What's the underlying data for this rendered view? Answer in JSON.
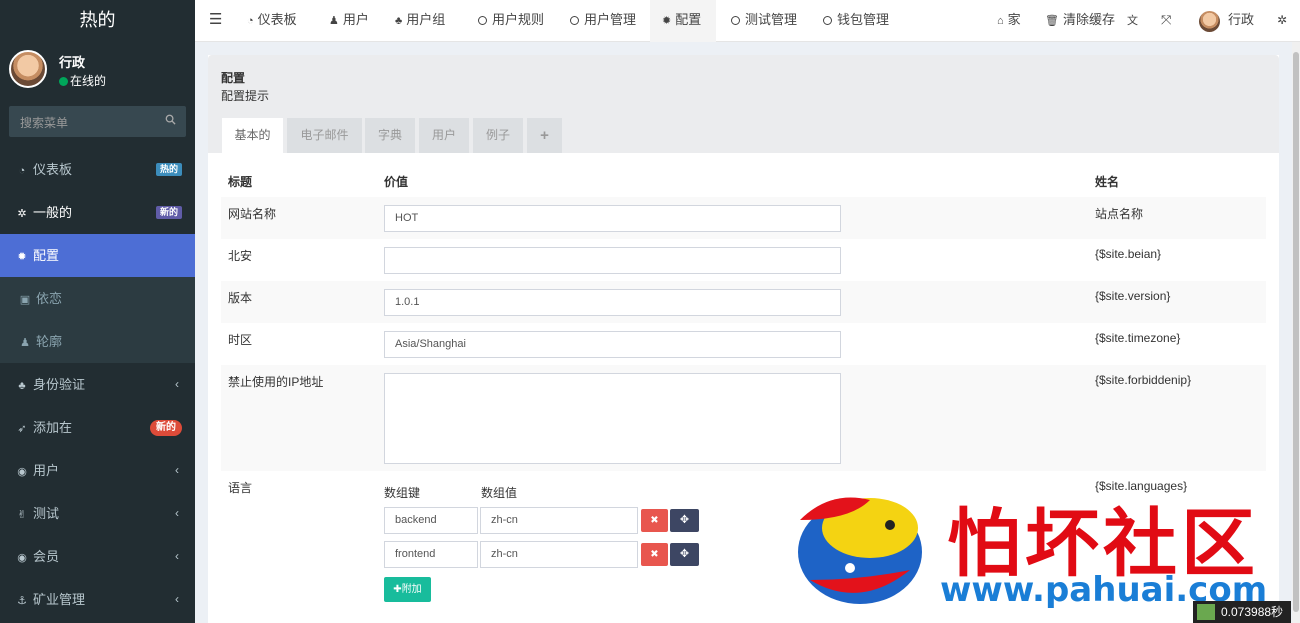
{
  "sidebar": {
    "brand": "热的",
    "user": {
      "name": "行政",
      "status": "在线的"
    },
    "search_placeholder": "搜索菜单",
    "items": [
      {
        "label": "仪表板",
        "icon": "dashboard-icon",
        "badge": "热的"
      },
      {
        "label": "一般的",
        "icon": "cogs-icon",
        "badge": "新的"
      },
      {
        "label": "配置",
        "icon": "gear-icon"
      },
      {
        "label": "依恋",
        "icon": "image-icon"
      },
      {
        "label": "轮廓",
        "icon": "user-icon"
      },
      {
        "label": "身份验证",
        "icon": "group-icon"
      },
      {
        "label": "添加在",
        "icon": "rocket-icon",
        "badge": "新的"
      },
      {
        "label": "用户",
        "icon": "user-circle-icon"
      },
      {
        "label": "测试",
        "icon": "hand-icon"
      },
      {
        "label": "会员",
        "icon": "user-circle-icon"
      },
      {
        "label": "矿业管理",
        "icon": "anchor-icon"
      }
    ]
  },
  "topbar": {
    "nav": [
      "仪表板",
      "用户",
      "用户组",
      "用户规则",
      "用户管理",
      "配置",
      "测试管理",
      "钱包管理"
    ],
    "home": "家",
    "clear_cache": "清除缓存",
    "user": "行政"
  },
  "content": {
    "title": "配置",
    "subtitle": "配置提示",
    "tabs": [
      "基本的",
      "电子邮件",
      "字典",
      "用户",
      "例子",
      "+"
    ],
    "headers": {
      "title": "标题",
      "value": "价值",
      "name": "姓名"
    },
    "rows": [
      {
        "label": "网站名称",
        "value": "HOT",
        "name": "站点名称"
      },
      {
        "label": "北安",
        "value": "",
        "name": "{$site.beian}"
      },
      {
        "label": "版本",
        "value": "1.0.1",
        "name": "{$site.version}"
      },
      {
        "label": "时区",
        "value": "Asia/Shanghai",
        "name": "{$site.timezone}"
      },
      {
        "label": "禁止使用的IP地址",
        "value": "",
        "name": "{$site.forbiddenip}"
      },
      {
        "label": "语言",
        "name": "{$site.languages}"
      }
    ],
    "language": {
      "key_header": "数组键",
      "value_header": "数组值",
      "pairs": [
        {
          "key": "backend",
          "value": "zh-cn"
        },
        {
          "key": "frontend",
          "value": "zh-cn"
        }
      ],
      "add_label": "附加"
    }
  },
  "watermark": {
    "text": "怕坏社区",
    "url": "www.pahuai.com"
  },
  "timer": "0.073988秒",
  "colors": {
    "sidebar_bg": "#222d32",
    "active": "#4d6ed5",
    "danger": "#e8564e",
    "success": "#18bc9c"
  }
}
